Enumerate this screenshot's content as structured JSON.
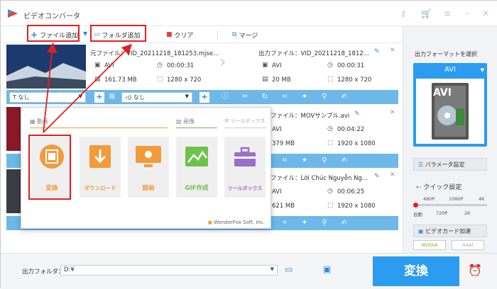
{
  "app": {
    "title": "ビデオコンバータ"
  },
  "toolbar": {
    "add_file": "ファイル追加",
    "add_folder": "フォルダ追加",
    "clear": "クリア",
    "merge": "マージ"
  },
  "files": [
    {
      "source_name": "元ファイル：VID_20211218_181253.mjse...",
      "source_format": "AVI",
      "source_duration": "00:00:31",
      "source_size": "161.73 MB",
      "source_resolution": "1280 x 720",
      "output_name": "出力ファイル：VID_20211218_1812...",
      "output_format": "AVI",
      "output_duration": "00:00:31",
      "output_size": "20 MB",
      "output_resolution": "1280 x 720"
    },
    {
      "output_name": "出力ファイル：MOVサンプル.avi",
      "output_format": "AVI",
      "output_duration": "00:04:22",
      "output_size": "379 MB",
      "output_resolution": "1920 x 1080"
    },
    {
      "output_name": "出力ファイル：Lời Chúc Nguyễn Ng...",
      "output_format": "AVI",
      "output_duration": "00:06:25",
      "output_size": "621 MB",
      "output_resolution": "1920 x 1080"
    }
  ],
  "controls": {
    "subtitle": "なし",
    "audio": "なし"
  },
  "popup": {
    "section_video": "動画",
    "section_image": "画像",
    "section_toolbox": "ツールボックス",
    "tiles": [
      "変換",
      "ダウンロード",
      "録画",
      "GIF作成",
      "ツールボックス"
    ],
    "footer": "WonderFox Soft, Inc."
  },
  "right_panel": {
    "format_title": "出力フォーマットを選択",
    "format_value": "AVI",
    "format_badge": "AVI",
    "param_button": "パラメータ設定",
    "quick_title": "クイック設定",
    "quality_top": [
      "480P",
      "1080P",
      "4K"
    ],
    "quality_bottom": [
      "自動",
      "720P",
      "2K"
    ],
    "gpu_title": "ビデオカード加速",
    "nvidia": "NVIDIA",
    "intel": "Intel"
  },
  "bottom": {
    "output_folder_label": "出力フォルダ：",
    "output_folder_value": "D:¥",
    "convert_button": "変換"
  },
  "colors": {
    "accent": "#2b9cf0",
    "control_bar": "#6db8e9",
    "highlight": "#e02020",
    "orange": "#f39a3a",
    "green": "#6cc24a",
    "purple": "#9a6fc8"
  }
}
